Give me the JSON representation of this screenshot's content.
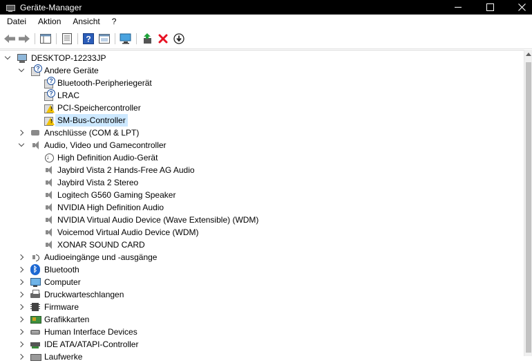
{
  "window": {
    "title": "Geräte-Manager",
    "icon": "device-manager-icon",
    "controls": [
      "minimize",
      "maximize",
      "close"
    ]
  },
  "menu": [
    "Datei",
    "Aktion",
    "Ansicht",
    "?"
  ],
  "toolbar": [
    {
      "name": "back-button",
      "icon": "arrow-left-icon"
    },
    {
      "name": "forward-button",
      "icon": "arrow-right-icon"
    },
    {
      "name": "properties-pane-button",
      "icon": "pane-icon"
    },
    {
      "name": "properties-button",
      "icon": "properties-icon"
    },
    {
      "name": "help-button",
      "icon": "help-icon"
    },
    {
      "name": "driver-view-button",
      "icon": "view-icon"
    },
    {
      "name": "scan-hardware-button",
      "icon": "monitor-scan-icon"
    },
    {
      "name": "update-driver-button",
      "icon": "update-driver-icon"
    },
    {
      "name": "uninstall-device-button",
      "icon": "red-x-icon"
    },
    {
      "name": "disable-device-button",
      "icon": "download-circle-icon"
    }
  ],
  "tree": {
    "root": "DESKTOP-12233JP",
    "rows": [
      {
        "label": "DESKTOP-12233JP",
        "level": 0,
        "expander": "down",
        "icon": "computer-icon"
      },
      {
        "label": "Andere Geräte",
        "level": 1,
        "expander": "down",
        "icon": "unknown-device-icon"
      },
      {
        "label": "Bluetooth-Peripheriegerät",
        "level": 2,
        "expander": "none",
        "icon": "unknown-device-icon"
      },
      {
        "label": "LRAC",
        "level": 2,
        "expander": "none",
        "icon": "unknown-device-icon"
      },
      {
        "label": "PCI-Speichercontroller",
        "level": 2,
        "expander": "none",
        "icon": "warning-device-icon"
      },
      {
        "label": "SM-Bus-Controller",
        "level": 2,
        "expander": "none",
        "icon": "warning-device-icon",
        "selected": true
      },
      {
        "label": "Anschlüsse (COM & LPT)",
        "level": 1,
        "expander": "right",
        "icon": "port-icon"
      },
      {
        "label": "Audio, Video und Gamecontroller",
        "level": 1,
        "expander": "down",
        "icon": "speaker-icon"
      },
      {
        "label": "High Definition Audio-Gerät",
        "level": 2,
        "expander": "none",
        "icon": "hd-audio-icon"
      },
      {
        "label": "Jaybird Vista 2 Hands-Free AG Audio",
        "level": 2,
        "expander": "none",
        "icon": "speaker-icon"
      },
      {
        "label": "Jaybird Vista 2 Stereo",
        "level": 2,
        "expander": "none",
        "icon": "speaker-icon"
      },
      {
        "label": "Logitech G560 Gaming Speaker",
        "level": 2,
        "expander": "none",
        "icon": "speaker-icon"
      },
      {
        "label": "NVIDIA High Definition Audio",
        "level": 2,
        "expander": "none",
        "icon": "speaker-icon"
      },
      {
        "label": "NVIDIA Virtual Audio Device (Wave Extensible) (WDM)",
        "level": 2,
        "expander": "none",
        "icon": "speaker-icon"
      },
      {
        "label": "Voicemod Virtual Audio Device (WDM)",
        "level": 2,
        "expander": "none",
        "icon": "speaker-icon"
      },
      {
        "label": "XONAR SOUND CARD",
        "level": 2,
        "expander": "none",
        "icon": "speaker-icon"
      },
      {
        "label": "Audioeingänge und -ausgänge",
        "level": 1,
        "expander": "right",
        "icon": "audio-io-icon"
      },
      {
        "label": "Bluetooth",
        "level": 1,
        "expander": "right",
        "icon": "bluetooth-icon"
      },
      {
        "label": "Computer",
        "level": 1,
        "expander": "right",
        "icon": "monitor-icon"
      },
      {
        "label": "Druckwarteschlangen",
        "level": 1,
        "expander": "right",
        "icon": "printer-icon"
      },
      {
        "label": "Firmware",
        "level": 1,
        "expander": "right",
        "icon": "firmware-icon"
      },
      {
        "label": "Grafikkarten",
        "level": 1,
        "expander": "right",
        "icon": "graphics-card-icon"
      },
      {
        "label": "Human Interface Devices",
        "level": 1,
        "expander": "right",
        "icon": "hid-icon"
      },
      {
        "label": "IDE ATA/ATAPI-Controller",
        "level": 1,
        "expander": "right",
        "icon": "ide-controller-icon"
      },
      {
        "label": "Laufwerke",
        "level": 1,
        "expander": "right",
        "icon": "drive-icon"
      }
    ]
  },
  "colors": {
    "titlebar_bg": "#000000",
    "selection_bg": "#cce8ff",
    "warning": "#f2c200",
    "uninstall_red": "#e81123"
  }
}
